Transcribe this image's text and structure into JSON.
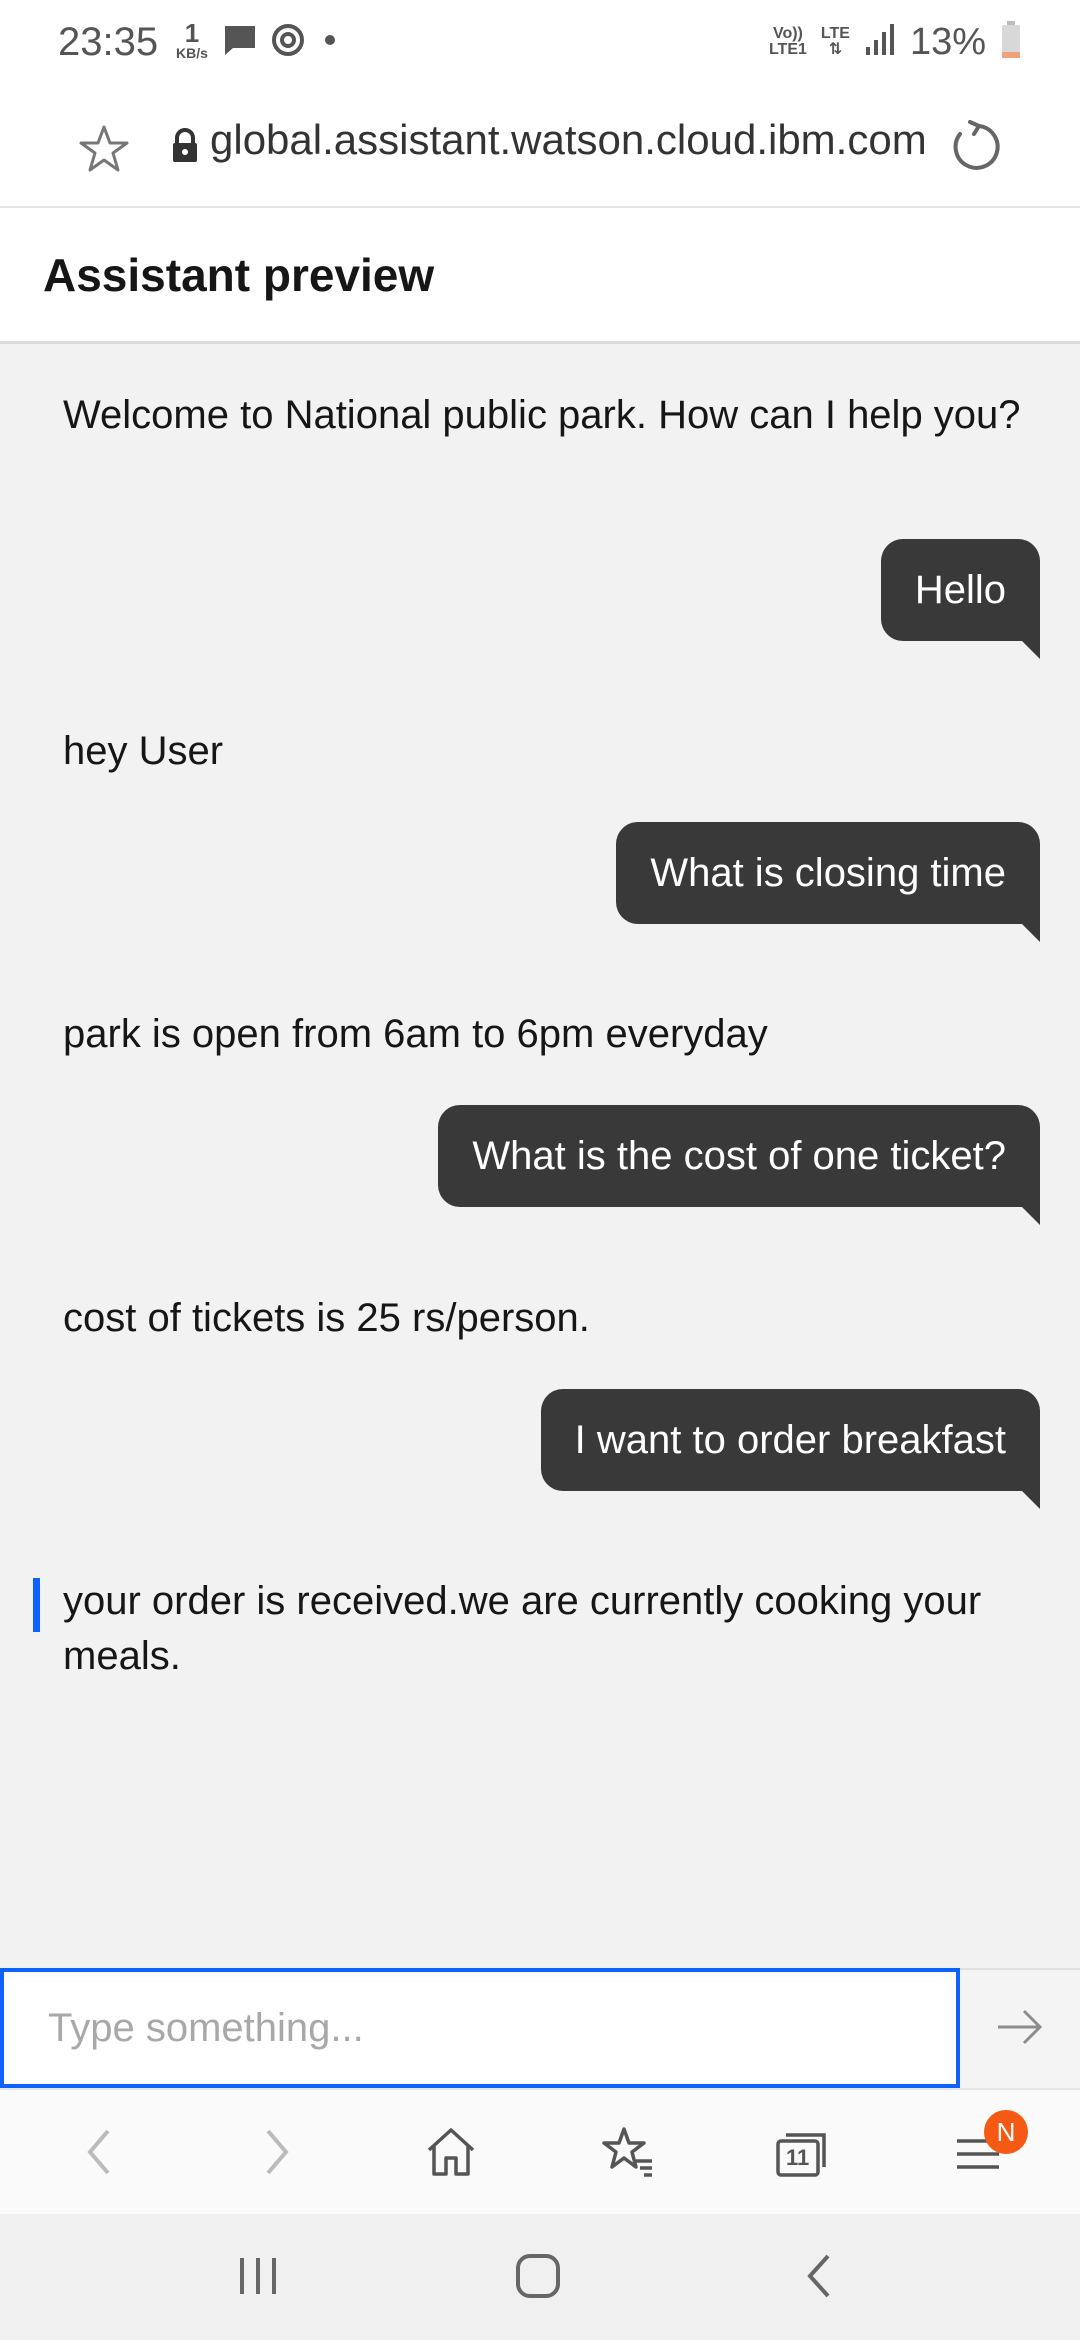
{
  "status_bar": {
    "time": "23:35",
    "net_speed_value": "1",
    "net_speed_unit": "KB/s",
    "volte_top": "Vo))",
    "volte_bottom": "LTE1",
    "lte_label": "LTE",
    "battery_percent": "13%"
  },
  "browser": {
    "url": "global.assistant.watson.cloud.ibm.com"
  },
  "header": {
    "title": "Assistant preview"
  },
  "messages": [
    {
      "from": "bot",
      "text": "Welcome to National public park. How can I help you?"
    },
    {
      "from": "user",
      "text": "Hello"
    },
    {
      "from": "bot",
      "text": "hey User"
    },
    {
      "from": "user",
      "text": "What is closing time"
    },
    {
      "from": "bot",
      "text": "park is open from 6am to 6pm everyday"
    },
    {
      "from": "user",
      "text": "What is the cost of one ticket?"
    },
    {
      "from": "bot",
      "text": "cost of tickets is 25 rs/person."
    },
    {
      "from": "user",
      "text": "I want to order breakfast"
    },
    {
      "from": "bot",
      "text": "your order is received.we are currently cooking your meals."
    }
  ],
  "input": {
    "placeholder": "Type something...",
    "value": ""
  },
  "toolbar": {
    "tab_count": "11",
    "menu_badge": "N"
  },
  "colors": {
    "accent": "#0f62fe",
    "user_bubble": "#393939",
    "chat_background": "#f2f2f2",
    "badge": "#f45a14"
  },
  "icons": {
    "send": "arrow-right-icon",
    "back": "chevron-left-icon",
    "forward": "chevron-right-icon",
    "home": "home-icon",
    "bookmarks": "star-list-icon",
    "tabs": "tabs-icon",
    "menu": "hamburger-menu-icon"
  }
}
